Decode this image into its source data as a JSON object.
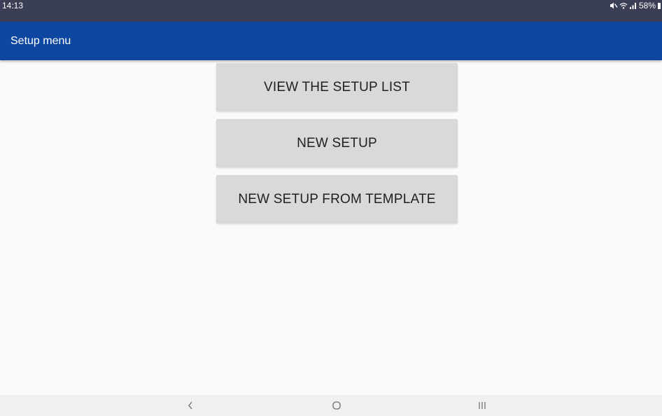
{
  "status_bar": {
    "time": "14:13",
    "battery_text": "58%",
    "icons": [
      "mute-icon",
      "wifi-icon",
      "signal-icon",
      "battery-icon"
    ]
  },
  "app_bar": {
    "title": "Setup menu",
    "color": "#0d47a1"
  },
  "menu": {
    "buttons": [
      {
        "label": "VIEW THE SETUP LIST"
      },
      {
        "label": "NEW SETUP"
      },
      {
        "label": "NEW SETUP FROM TEMPLATE"
      }
    ]
  },
  "nav_bar": {
    "icons": [
      "back-icon",
      "home-icon",
      "recents-icon"
    ]
  },
  "colors": {
    "status_bar": "#3b3f55",
    "background": "#fafafa",
    "button": "#d8d9d9",
    "button_text": "#1f1f1f"
  }
}
